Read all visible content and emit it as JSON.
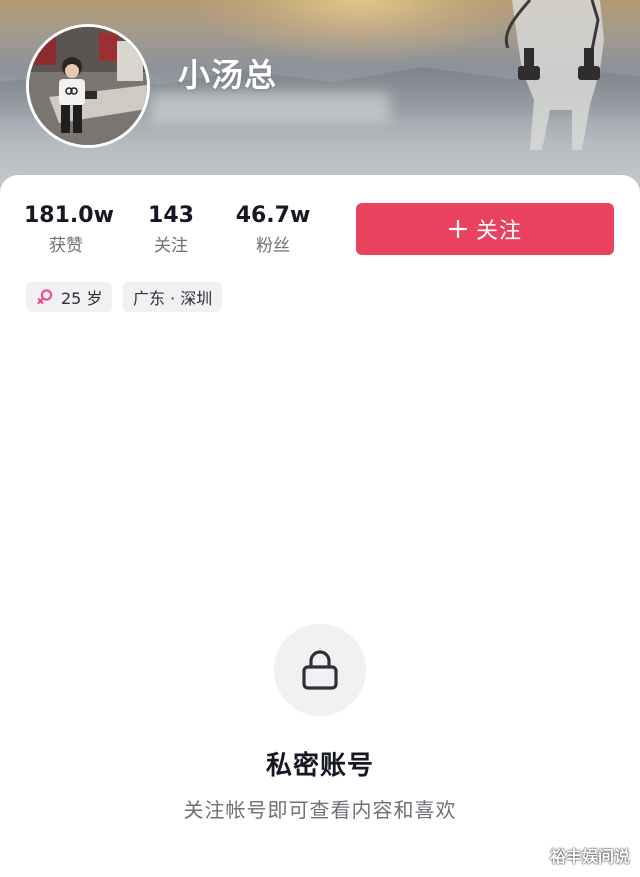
{
  "profile": {
    "username": "小汤总",
    "avatar_icon": "user-avatar-photo"
  },
  "stats": {
    "likes": {
      "value": "181.0w",
      "label": "获赞"
    },
    "following": {
      "value": "143",
      "label": "关注"
    },
    "fans": {
      "value": "46.7w",
      "label": "粉丝"
    }
  },
  "follow_button": {
    "label": "关注",
    "icon": "plus-icon",
    "color": "#e9425e"
  },
  "tags": {
    "age": {
      "icon": "female-icon",
      "text": "25 岁"
    },
    "location": {
      "text": "广东 · 深圳"
    }
  },
  "private_notice": {
    "icon": "lock-icon",
    "title": "私密账号",
    "description": "关注帐号即可查看内容和喜欢"
  },
  "watermark": "裕丰娱间说",
  "colors": {
    "accent": "#e9425e",
    "female": "#e9508d"
  }
}
